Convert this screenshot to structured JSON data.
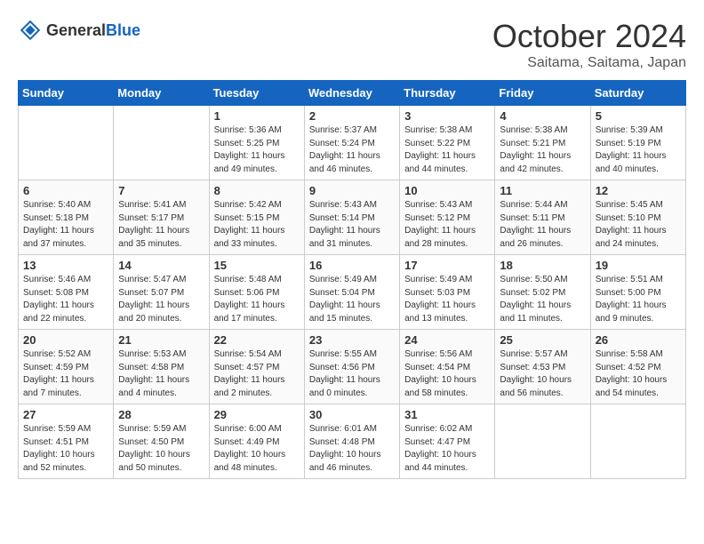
{
  "header": {
    "logo_general": "General",
    "logo_blue": "Blue",
    "month_year": "October 2024",
    "location": "Saitama, Saitama, Japan"
  },
  "weekdays": [
    "Sunday",
    "Monday",
    "Tuesday",
    "Wednesday",
    "Thursday",
    "Friday",
    "Saturday"
  ],
  "weeks": [
    [
      {
        "day": "",
        "sunrise": "",
        "sunset": "",
        "daylight": ""
      },
      {
        "day": "",
        "sunrise": "",
        "sunset": "",
        "daylight": ""
      },
      {
        "day": "1",
        "sunrise": "Sunrise: 5:36 AM",
        "sunset": "Sunset: 5:25 PM",
        "daylight": "Daylight: 11 hours and 49 minutes."
      },
      {
        "day": "2",
        "sunrise": "Sunrise: 5:37 AM",
        "sunset": "Sunset: 5:24 PM",
        "daylight": "Daylight: 11 hours and 46 minutes."
      },
      {
        "day": "3",
        "sunrise": "Sunrise: 5:38 AM",
        "sunset": "Sunset: 5:22 PM",
        "daylight": "Daylight: 11 hours and 44 minutes."
      },
      {
        "day": "4",
        "sunrise": "Sunrise: 5:38 AM",
        "sunset": "Sunset: 5:21 PM",
        "daylight": "Daylight: 11 hours and 42 minutes."
      },
      {
        "day": "5",
        "sunrise": "Sunrise: 5:39 AM",
        "sunset": "Sunset: 5:19 PM",
        "daylight": "Daylight: 11 hours and 40 minutes."
      }
    ],
    [
      {
        "day": "6",
        "sunrise": "Sunrise: 5:40 AM",
        "sunset": "Sunset: 5:18 PM",
        "daylight": "Daylight: 11 hours and 37 minutes."
      },
      {
        "day": "7",
        "sunrise": "Sunrise: 5:41 AM",
        "sunset": "Sunset: 5:17 PM",
        "daylight": "Daylight: 11 hours and 35 minutes."
      },
      {
        "day": "8",
        "sunrise": "Sunrise: 5:42 AM",
        "sunset": "Sunset: 5:15 PM",
        "daylight": "Daylight: 11 hours and 33 minutes."
      },
      {
        "day": "9",
        "sunrise": "Sunrise: 5:43 AM",
        "sunset": "Sunset: 5:14 PM",
        "daylight": "Daylight: 11 hours and 31 minutes."
      },
      {
        "day": "10",
        "sunrise": "Sunrise: 5:43 AM",
        "sunset": "Sunset: 5:12 PM",
        "daylight": "Daylight: 11 hours and 28 minutes."
      },
      {
        "day": "11",
        "sunrise": "Sunrise: 5:44 AM",
        "sunset": "Sunset: 5:11 PM",
        "daylight": "Daylight: 11 hours and 26 minutes."
      },
      {
        "day": "12",
        "sunrise": "Sunrise: 5:45 AM",
        "sunset": "Sunset: 5:10 PM",
        "daylight": "Daylight: 11 hours and 24 minutes."
      }
    ],
    [
      {
        "day": "13",
        "sunrise": "Sunrise: 5:46 AM",
        "sunset": "Sunset: 5:08 PM",
        "daylight": "Daylight: 11 hours and 22 minutes."
      },
      {
        "day": "14",
        "sunrise": "Sunrise: 5:47 AM",
        "sunset": "Sunset: 5:07 PM",
        "daylight": "Daylight: 11 hours and 20 minutes."
      },
      {
        "day": "15",
        "sunrise": "Sunrise: 5:48 AM",
        "sunset": "Sunset: 5:06 PM",
        "daylight": "Daylight: 11 hours and 17 minutes."
      },
      {
        "day": "16",
        "sunrise": "Sunrise: 5:49 AM",
        "sunset": "Sunset: 5:04 PM",
        "daylight": "Daylight: 11 hours and 15 minutes."
      },
      {
        "day": "17",
        "sunrise": "Sunrise: 5:49 AM",
        "sunset": "Sunset: 5:03 PM",
        "daylight": "Daylight: 11 hours and 13 minutes."
      },
      {
        "day": "18",
        "sunrise": "Sunrise: 5:50 AM",
        "sunset": "Sunset: 5:02 PM",
        "daylight": "Daylight: 11 hours and 11 minutes."
      },
      {
        "day": "19",
        "sunrise": "Sunrise: 5:51 AM",
        "sunset": "Sunset: 5:00 PM",
        "daylight": "Daylight: 11 hours and 9 minutes."
      }
    ],
    [
      {
        "day": "20",
        "sunrise": "Sunrise: 5:52 AM",
        "sunset": "Sunset: 4:59 PM",
        "daylight": "Daylight: 11 hours and 7 minutes."
      },
      {
        "day": "21",
        "sunrise": "Sunrise: 5:53 AM",
        "sunset": "Sunset: 4:58 PM",
        "daylight": "Daylight: 11 hours and 4 minutes."
      },
      {
        "day": "22",
        "sunrise": "Sunrise: 5:54 AM",
        "sunset": "Sunset: 4:57 PM",
        "daylight": "Daylight: 11 hours and 2 minutes."
      },
      {
        "day": "23",
        "sunrise": "Sunrise: 5:55 AM",
        "sunset": "Sunset: 4:56 PM",
        "daylight": "Daylight: 11 hours and 0 minutes."
      },
      {
        "day": "24",
        "sunrise": "Sunrise: 5:56 AM",
        "sunset": "Sunset: 4:54 PM",
        "daylight": "Daylight: 10 hours and 58 minutes."
      },
      {
        "day": "25",
        "sunrise": "Sunrise: 5:57 AM",
        "sunset": "Sunset: 4:53 PM",
        "daylight": "Daylight: 10 hours and 56 minutes."
      },
      {
        "day": "26",
        "sunrise": "Sunrise: 5:58 AM",
        "sunset": "Sunset: 4:52 PM",
        "daylight": "Daylight: 10 hours and 54 minutes."
      }
    ],
    [
      {
        "day": "27",
        "sunrise": "Sunrise: 5:59 AM",
        "sunset": "Sunset: 4:51 PM",
        "daylight": "Daylight: 10 hours and 52 minutes."
      },
      {
        "day": "28",
        "sunrise": "Sunrise: 5:59 AM",
        "sunset": "Sunset: 4:50 PM",
        "daylight": "Daylight: 10 hours and 50 minutes."
      },
      {
        "day": "29",
        "sunrise": "Sunrise: 6:00 AM",
        "sunset": "Sunset: 4:49 PM",
        "daylight": "Daylight: 10 hours and 48 minutes."
      },
      {
        "day": "30",
        "sunrise": "Sunrise: 6:01 AM",
        "sunset": "Sunset: 4:48 PM",
        "daylight": "Daylight: 10 hours and 46 minutes."
      },
      {
        "day": "31",
        "sunrise": "Sunrise: 6:02 AM",
        "sunset": "Sunset: 4:47 PM",
        "daylight": "Daylight: 10 hours and 44 minutes."
      },
      {
        "day": "",
        "sunrise": "",
        "sunset": "",
        "daylight": ""
      },
      {
        "day": "",
        "sunrise": "",
        "sunset": "",
        "daylight": ""
      }
    ]
  ]
}
